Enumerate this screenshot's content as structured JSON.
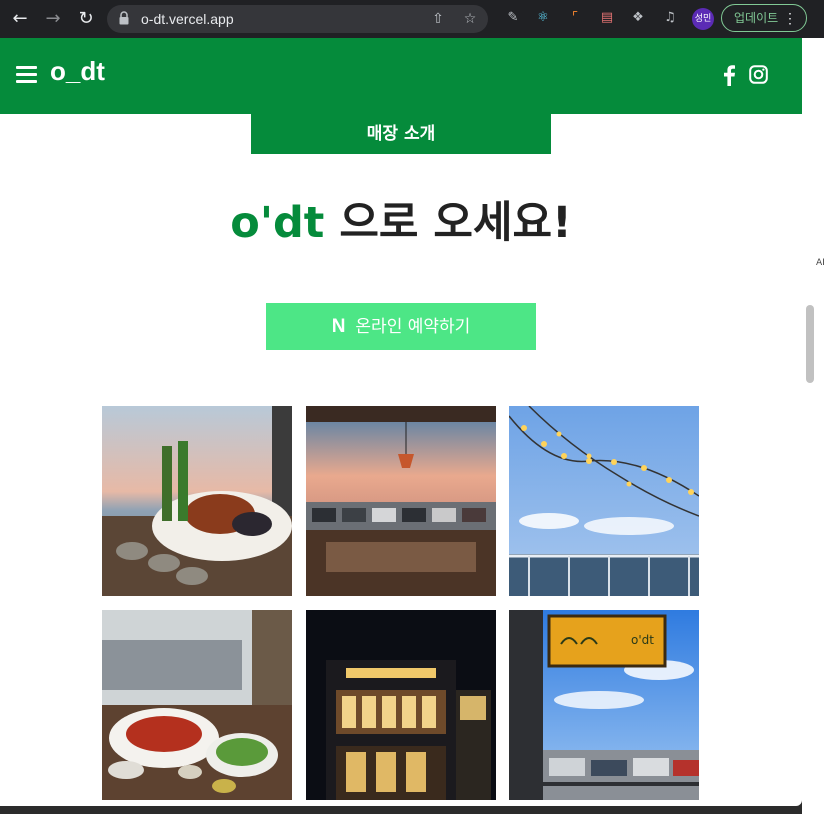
{
  "browser": {
    "url": "o-dt.vercel.app",
    "profile_label": "성민",
    "update_label": "업데이트"
  },
  "site": {
    "brand": "o_dt",
    "section_title": "매장 소개",
    "headline_accent": "o'dt",
    "headline_rest": " 으로 오세요!",
    "reserve_icon": "N",
    "reserve_label": "온라인 예약하기",
    "side_fragment": "AI"
  },
  "colors": {
    "brand_green": "#058b3b",
    "button_green": "#4de686"
  },
  "photos": [
    {
      "name": "photo-seafood-beer"
    },
    {
      "name": "photo-cafe-window-sunset"
    },
    {
      "name": "photo-string-lights-sky"
    },
    {
      "name": "photo-crayfish-salad"
    },
    {
      "name": "photo-building-night"
    },
    {
      "name": "photo-odt-sign"
    }
  ],
  "icons": [
    "back-icon",
    "forward-icon",
    "reload-icon",
    "lock-icon",
    "share-icon",
    "star-icon",
    "menu-icon",
    "facebook-icon",
    "instagram-icon"
  ]
}
